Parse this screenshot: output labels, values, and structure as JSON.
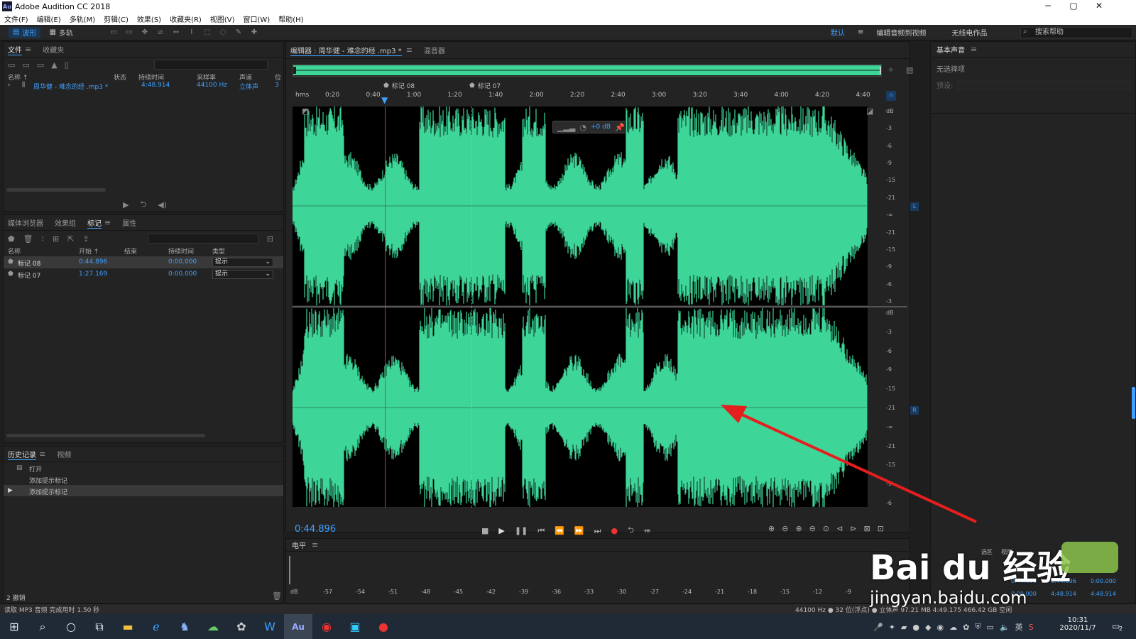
{
  "app": {
    "title": "Adobe Audition CC 2018",
    "logo": "Au"
  },
  "window_controls": {
    "minimize": "−",
    "maximize": "▢",
    "close": "✕"
  },
  "menu": [
    "文件(F)",
    "编辑(E)",
    "多轨(M)",
    "剪辑(C)",
    "效果(S)",
    "收藏夹(R)",
    "视图(V)",
    "窗口(W)",
    "帮助(H)"
  ],
  "toolbar": {
    "waveform_label": "波形",
    "multitrack_label": "多轨",
    "workspaces": [
      "默认",
      "编辑音频到视频",
      "无线电作品"
    ],
    "workspace_more": "»",
    "help_search_placeholder": "搜索帮助"
  },
  "files_panel": {
    "tabs": [
      "文件",
      "收藏夹"
    ],
    "columns": [
      "名称 ↑",
      "状态",
      "持续时间",
      "采样率",
      "声道",
      "位"
    ],
    "rows": [
      {
        "name": "周华健 - 难念的经 .mp3 *",
        "status": "",
        "duration": "4:48.914",
        "sample_rate": "44100 Hz",
        "channels": "立体声",
        "bits": "3"
      }
    ]
  },
  "markers_panel": {
    "tabs": [
      "媒体浏览器",
      "效果组",
      "标记",
      "属性"
    ],
    "columns": [
      "名称",
      "开始 ↑",
      "结束",
      "持续时间",
      "类型"
    ],
    "rows": [
      {
        "name": "标记 08",
        "start": "0:44.896",
        "end": "",
        "duration": "0:00.000",
        "type": "提示"
      },
      {
        "name": "标记 07",
        "start": "1:27.169",
        "end": "",
        "duration": "0:00.000",
        "type": "提示"
      }
    ]
  },
  "history_panel": {
    "tabs": [
      "历史记录",
      "视频"
    ],
    "items": [
      "打开",
      "添加提示标记",
      "添加提示标记"
    ],
    "undo_count": "2 撤销"
  },
  "editor": {
    "tab_title": "编辑器 : 周华健 - 难念的经 .mp3 *",
    "mixer_tab": "混音器",
    "ruler_unit": "hms",
    "ruler_ticks": [
      "0:20",
      "0:40",
      "1:00",
      "1:20",
      "1:40",
      "2:00",
      "2:20",
      "2:40",
      "3:00",
      "3:20",
      "3:40",
      "4:00",
      "4:20",
      "4:40"
    ],
    "markers": [
      "标记 08",
      "标记 07"
    ],
    "hud_gain": "+0 dB",
    "db_labels_upper": [
      "dB",
      "-3",
      "-6",
      "-9",
      "-15",
      "-21",
      "-∞",
      "-21",
      "-15",
      "-9",
      "-6",
      "-3"
    ],
    "db_labels_lower": [
      "dB",
      "-3",
      "-6",
      "-9",
      "-15",
      "-21",
      "-∞",
      "-21",
      "-15",
      "-9",
      "-6"
    ],
    "channel_left": "L",
    "channel_right": "R",
    "timecode": "0:44.896",
    "waveform_color": "#3ed598"
  },
  "levels_panel": {
    "title": "电平",
    "scale": [
      "dB",
      "-57",
      "-54",
      "-51",
      "-48",
      "-45",
      "-42",
      "-39",
      "-36",
      "-33",
      "-30",
      "-27",
      "-24",
      "-21",
      "-18",
      "-15",
      "-12",
      "-9"
    ]
  },
  "properties_panel": {
    "title": "基本声音",
    "no_selection": "无选择项",
    "preset_label": "预设:"
  },
  "status": {
    "message": "读取 MP3 音频 完成用时 1.50 秒",
    "right": "44100 Hz ● 32 位(浮点) ● 立体声   97.21 MB   4:49.175   466.42 GB 空闲"
  },
  "selection_view": {
    "labels": [
      "选区",
      "视图"
    ],
    "sel": [
      "0:44.896",
      "0:44.896",
      "0:00.000"
    ],
    "view": [
      "0:00.000",
      "4:48.914",
      "4:48.914"
    ]
  },
  "taskbar": {
    "clock_time": "10:31",
    "clock_date": "2020/11/7",
    "ime": "英",
    "notify": "2"
  },
  "watermark": {
    "brand": "Bai du 经验",
    "url": "jingyan.baidu.com"
  }
}
